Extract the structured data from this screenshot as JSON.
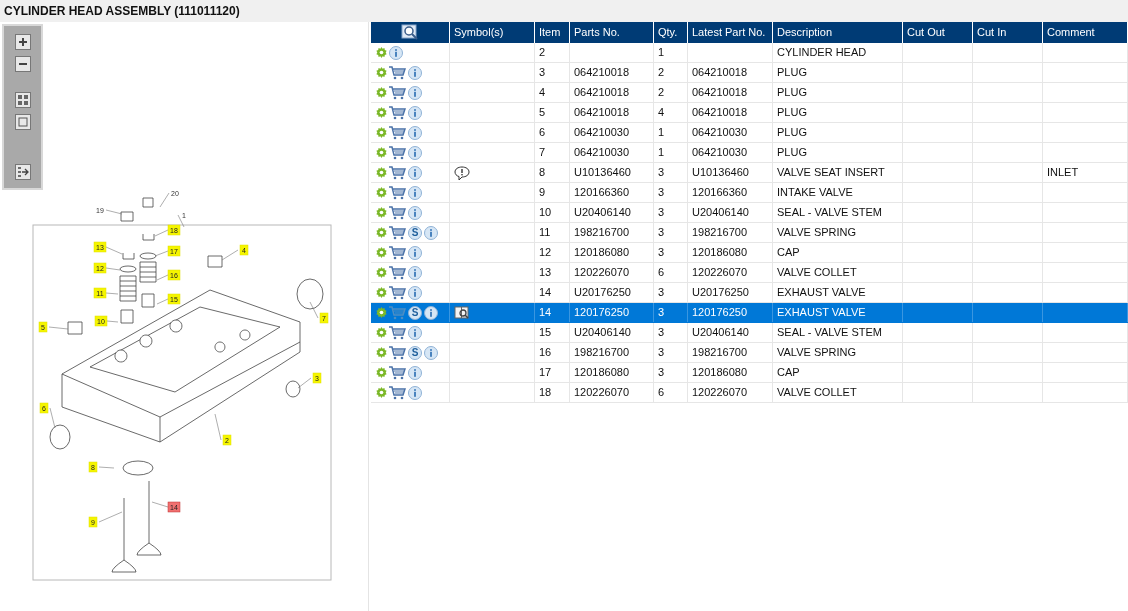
{
  "title": "CYLINDER HEAD ASSEMBLY (111011120)",
  "diagram": {
    "callouts": [
      {
        "label": "20",
        "kind": "plain"
      },
      {
        "label": "19",
        "kind": "plain"
      },
      {
        "label": "1",
        "kind": "plain"
      },
      {
        "label": "18",
        "kind": "tag",
        "selected": false
      },
      {
        "label": "13",
        "kind": "tag",
        "selected": false
      },
      {
        "label": "17",
        "kind": "tag",
        "selected": false
      },
      {
        "label": "4",
        "kind": "tag",
        "selected": false
      },
      {
        "label": "12",
        "kind": "tag",
        "selected": false
      },
      {
        "label": "16",
        "kind": "tag",
        "selected": false
      },
      {
        "label": "11",
        "kind": "tag",
        "selected": false
      },
      {
        "label": "15",
        "kind": "tag",
        "selected": false
      },
      {
        "label": "7",
        "kind": "tag",
        "selected": false
      },
      {
        "label": "10",
        "kind": "tag",
        "selected": false
      },
      {
        "label": "5",
        "kind": "tag",
        "selected": false
      },
      {
        "label": "3",
        "kind": "tag",
        "selected": false
      },
      {
        "label": "6",
        "kind": "tag",
        "selected": false
      },
      {
        "label": "2",
        "kind": "tag",
        "selected": false
      },
      {
        "label": "8",
        "kind": "tag",
        "selected": false
      },
      {
        "label": "14",
        "kind": "tag",
        "selected": true
      },
      {
        "label": "9",
        "kind": "tag",
        "selected": false
      }
    ]
  },
  "table": {
    "columns": [
      "Symbol(s)",
      "Item",
      "Parts No.",
      "Qty.",
      "Latest Part No.",
      "Description",
      "Cut Out",
      "Cut In",
      "Comment"
    ],
    "rows": [
      {
        "item": "2",
        "qty": "1",
        "description": "CYLINDER HEAD",
        "cart": false,
        "selected": false
      },
      {
        "item": "3",
        "parts_no": "064210018",
        "qty": "2",
        "latest": "064210018",
        "description": "PLUG",
        "cart": true,
        "cart_disabled": false,
        "selected": false
      },
      {
        "item": "4",
        "parts_no": "064210018",
        "qty": "2",
        "latest": "064210018",
        "description": "PLUG",
        "cart": true,
        "cart_disabled": false,
        "selected": false
      },
      {
        "item": "5",
        "parts_no": "064210018",
        "qty": "4",
        "latest": "064210018",
        "description": "PLUG",
        "cart": true,
        "cart_disabled": false,
        "selected": false
      },
      {
        "item": "6",
        "parts_no": "064210030",
        "qty": "1",
        "latest": "064210030",
        "description": "PLUG",
        "cart": true,
        "cart_disabled": false,
        "selected": false
      },
      {
        "item": "7",
        "parts_no": "064210030",
        "qty": "1",
        "latest": "064210030",
        "description": "PLUG",
        "cart": true,
        "cart_disabled": false,
        "selected": false
      },
      {
        "item": "8",
        "parts_no": "U10136460",
        "qty": "3",
        "latest": "U10136460",
        "description": "VALVE SEAT INSERT",
        "comment": "INLET",
        "symbol": {
          "kind": "note"
        },
        "cart": true,
        "cart_disabled": false,
        "selected": false
      },
      {
        "item": "9",
        "parts_no": "120166360",
        "qty": "3",
        "latest": "120166360",
        "description": "INTAKE VALVE",
        "cart": true,
        "cart_disabled": false,
        "selected": false
      },
      {
        "item": "10",
        "parts_no": "U20406140",
        "qty": "3",
        "latest": "U20406140",
        "description": "SEAL - VALVE STEM",
        "cart": true,
        "cart_disabled": false,
        "selected": false
      },
      {
        "item": "11",
        "parts_no": "198216700",
        "qty": "3",
        "latest": "198216700",
        "description": "VALVE SPRING",
        "service": "S",
        "cart": true,
        "cart_disabled": false,
        "selected": false
      },
      {
        "item": "12",
        "parts_no": "120186080",
        "qty": "3",
        "latest": "120186080",
        "description": "CAP",
        "cart": true,
        "cart_disabled": false,
        "selected": false
      },
      {
        "item": "13",
        "parts_no": "120226070",
        "qty": "6",
        "latest": "120226070",
        "description": "VALVE COLLET",
        "cart": true,
        "cart_disabled": false,
        "selected": false
      },
      {
        "item": "14",
        "parts_no": "U20176250",
        "qty": "3",
        "latest": "U20176250",
        "description": "EXHAUST VALVE",
        "cart": true,
        "cart_disabled": false,
        "selected": false
      },
      {
        "item": "14",
        "parts_no": "120176250",
        "qty": "3",
        "latest": "120176250",
        "description": "EXHAUST VALVE",
        "service": "S",
        "symbol": {
          "kind": "document"
        },
        "cart": true,
        "cart_disabled": true,
        "selected": true
      },
      {
        "item": "15",
        "parts_no": "U20406140",
        "qty": "3",
        "latest": "U20406140",
        "description": "SEAL - VALVE STEM",
        "cart": true,
        "cart_disabled": false,
        "selected": false
      },
      {
        "item": "16",
        "parts_no": "198216700",
        "qty": "3",
        "latest": "198216700",
        "description": "VALVE SPRING",
        "service": "S",
        "cart": true,
        "cart_disabled": false,
        "selected": false
      },
      {
        "item": "17",
        "parts_no": "120186080",
        "qty": "3",
        "latest": "120186080",
        "description": "CAP",
        "cart": true,
        "cart_disabled": false,
        "selected": false
      },
      {
        "item": "18",
        "parts_no": "120226070",
        "qty": "6",
        "latest": "120226070",
        "description": "VALVE COLLET",
        "cart": true,
        "cart_disabled": false,
        "selected": false
      }
    ]
  }
}
